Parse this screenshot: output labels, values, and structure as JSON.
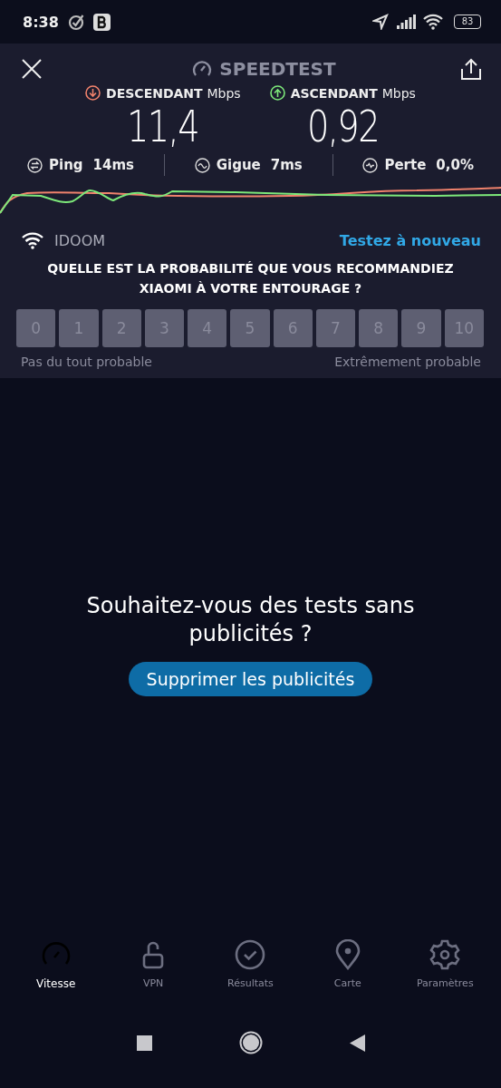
{
  "status_bar": {
    "time": "8:38",
    "battery": "83"
  },
  "header": {
    "title": "SPEEDTEST"
  },
  "results": [
    {
      "kind": "download",
      "label": "DESCENDANT",
      "unit": "Mbps",
      "value": "11,4"
    },
    {
      "kind": "upload",
      "label": "ASCENDANT",
      "unit": "Mbps",
      "value": "0,92"
    }
  ],
  "metrics": [
    {
      "kind": "ping",
      "label": "Ping",
      "value": "14ms"
    },
    {
      "kind": "jitter",
      "label": "Gigue",
      "value": "7ms"
    },
    {
      "kind": "loss",
      "label": "Perte",
      "value": "0,0%"
    }
  ],
  "network": {
    "name": "IDOOM",
    "retest": "Testez à nouveau"
  },
  "survey": {
    "question": "QUELLE EST LA PROBABILITÉ QUE VOUS RECOMMANDIEZ XIAOMI À VOTRE ENTOURAGE ?",
    "options": [
      "0",
      "1",
      "2",
      "3",
      "4",
      "5",
      "6",
      "7",
      "8",
      "9",
      "10"
    ],
    "low_label": "Pas du tout probable",
    "high_label": "Extrêmement probable"
  },
  "promo": {
    "text": "Souhaitez-vous des tests sans publicités ?",
    "button": "Supprimer les publicités"
  },
  "nav": [
    {
      "kind": "speed",
      "label": "Vitesse",
      "selected": true
    },
    {
      "kind": "vpn",
      "label": "VPN",
      "selected": false
    },
    {
      "kind": "results",
      "label": "Résultats",
      "selected": false
    },
    {
      "kind": "map",
      "label": "Carte",
      "selected": false
    },
    {
      "kind": "settings",
      "label": "Paramètres",
      "selected": false
    }
  ]
}
